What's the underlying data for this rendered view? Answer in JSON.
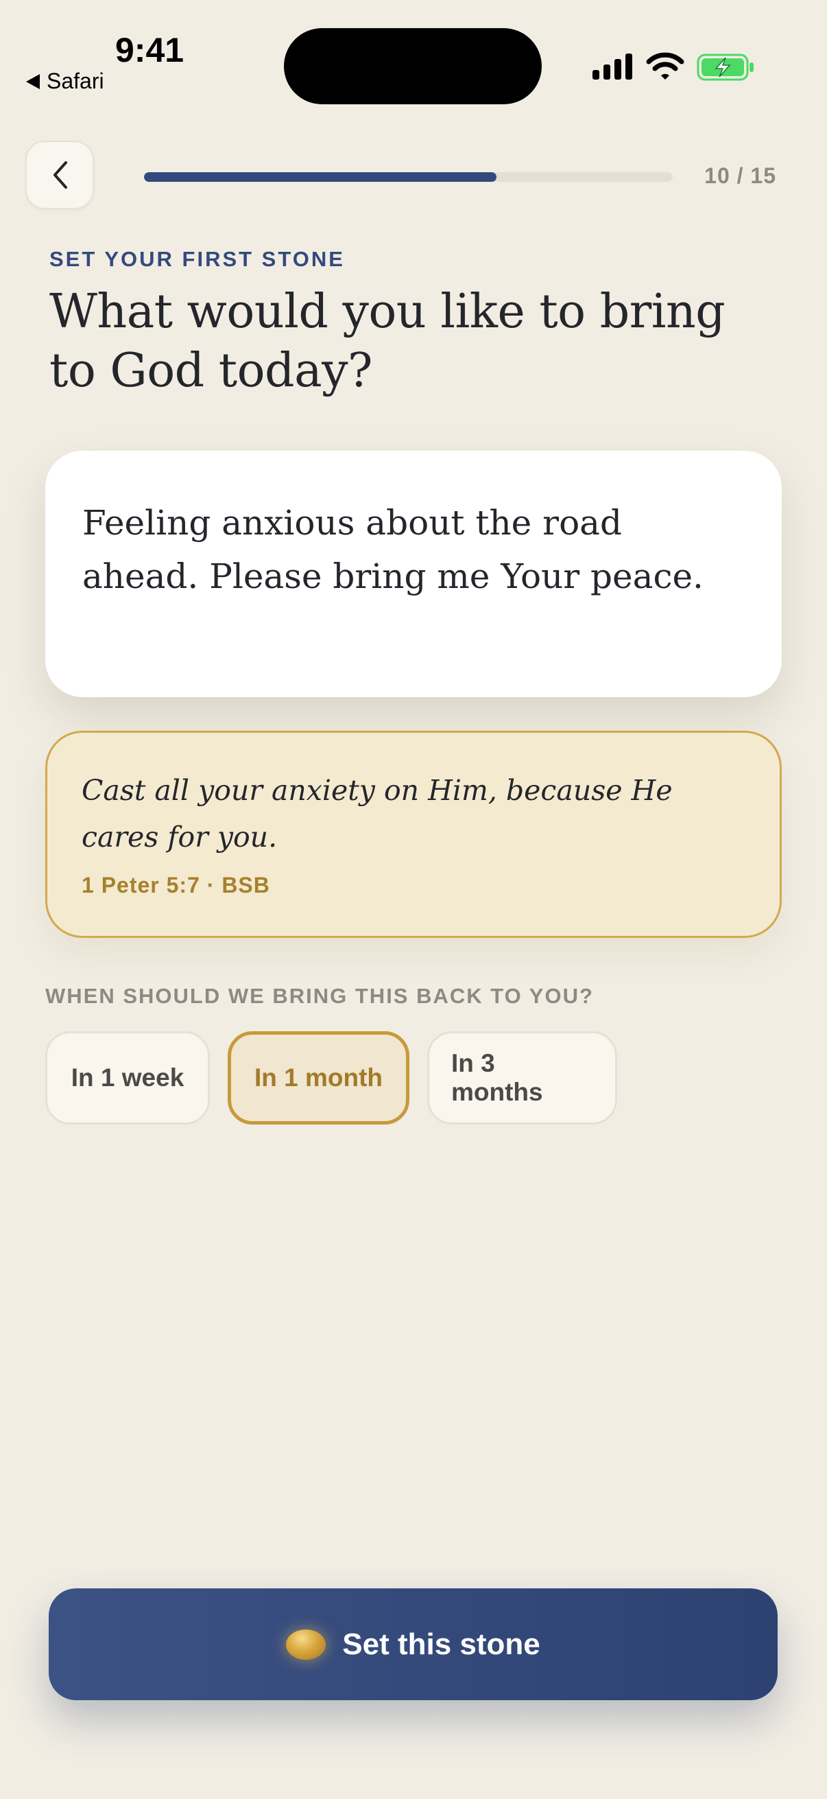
{
  "status_bar": {
    "time": "9:41",
    "back_app": "Safari"
  },
  "header": {
    "progress_label": "10 / 15",
    "progress_fraction": 0.6667
  },
  "eyebrow": "SET YOUR FIRST STONE",
  "question": "What would you like to bring to God today?",
  "prayer": {
    "text": "Feeling anxious about the road ahead. Please bring me Your peace."
  },
  "verse": {
    "text": "Cast all your anxiety on Him, because He cares for you.",
    "reference": "1 Peter 5:7 · BSB"
  },
  "reminder": {
    "label": "WHEN SHOULD WE BRING THIS BACK TO YOU?",
    "options": [
      "In 1 week",
      "In 1 month",
      "In 3 months"
    ],
    "selected": "In 1 month"
  },
  "cta": {
    "label": "Set this stone"
  },
  "colors": {
    "background": "#f1ede3",
    "primary": "#34497e",
    "accent_gold": "#c8993b",
    "verse_bg": "#f4ead0"
  },
  "icons": {
    "back": "chevron-left-icon",
    "signal": "cellular-signal-icon",
    "wifi": "wifi-icon",
    "battery": "battery-charging-icon",
    "stone": "golden-stone-icon"
  }
}
